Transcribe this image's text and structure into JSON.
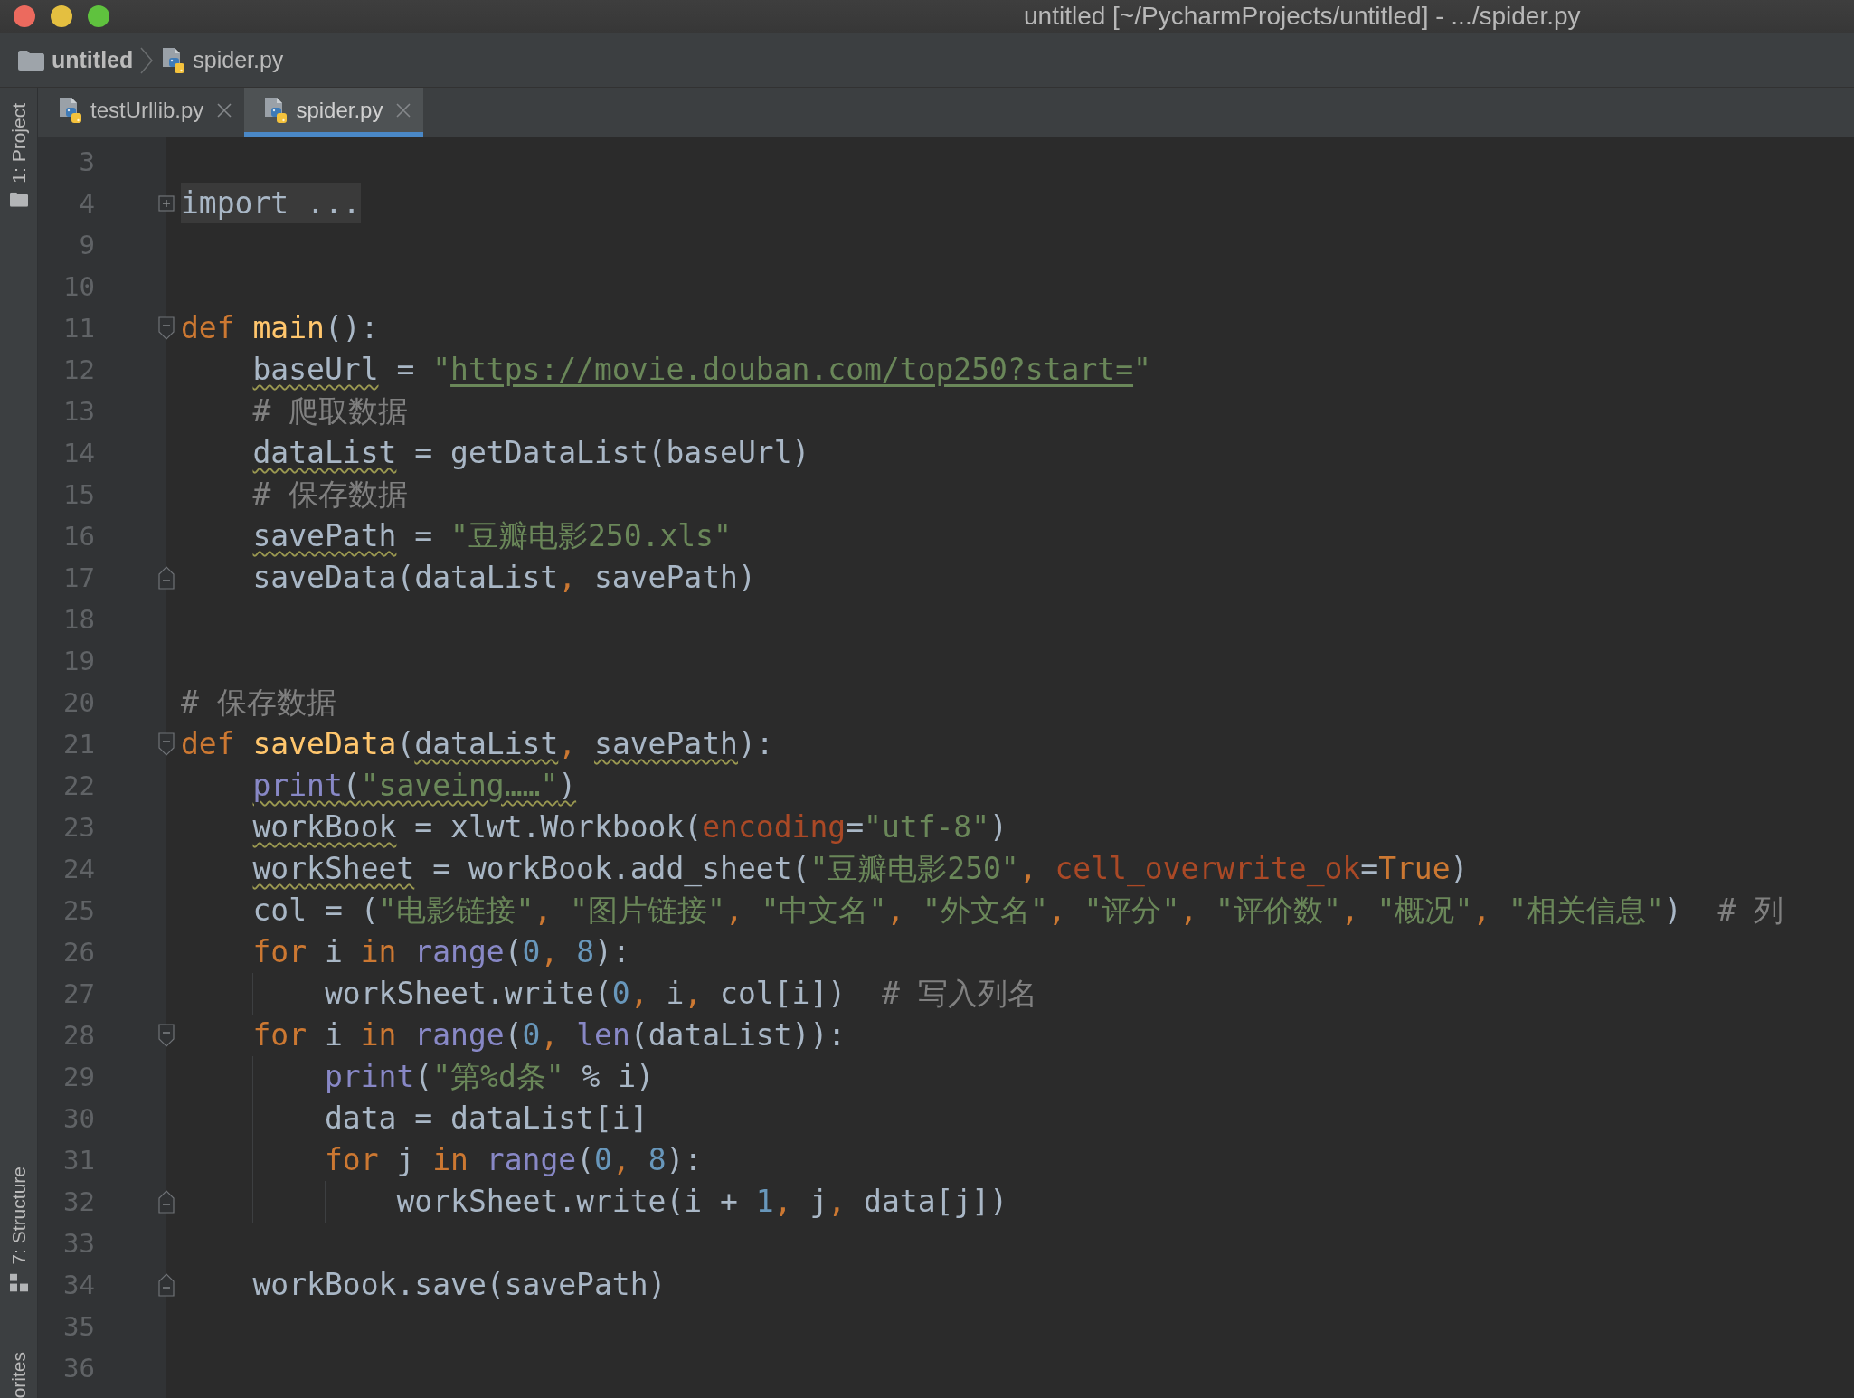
{
  "window": {
    "title": "untitled [~/PycharmProjects/untitled] - .../spider.py"
  },
  "breadcrumbs": [
    {
      "kind": "folder",
      "label": "untitled"
    },
    {
      "kind": "python_file",
      "label": "spider.py"
    }
  ],
  "tool_windows": {
    "top": [
      {
        "kind": "project",
        "label": "1: Project"
      }
    ],
    "bottom": [
      {
        "kind": "structure",
        "label": "7: Structure"
      },
      {
        "kind": "favorites",
        "label": "orites"
      }
    ]
  },
  "tabs": [
    {
      "label": "testUrllib.py",
      "selected": false
    },
    {
      "label": "spider.py",
      "selected": true
    }
  ],
  "editor": {
    "lines": [
      {
        "number": "3"
      },
      {
        "number": "4",
        "fold": {
          "kind": "start",
          "collapsed": true
        },
        "tokens": [
          {
            "kind": "folded",
            "text": "import ...",
            "warning": false
          }
        ]
      },
      {
        "number": "9"
      },
      {
        "number": "10"
      },
      {
        "number": "11",
        "fold": {
          "kind": "start",
          "collapsed": false
        },
        "tokens": [
          {
            "kind": "keyword",
            "text": "def ",
            "warning": false
          },
          {
            "kind": "function",
            "text": "main",
            "warning": false
          },
          {
            "kind": "plain",
            "text": "():",
            "warning": false
          }
        ]
      },
      {
        "number": "12",
        "tokens": [
          {
            "kind": "plain",
            "text": "    baseUrl",
            "warning": true
          },
          {
            "kind": "plain",
            "text": " = ",
            "warning": false
          },
          {
            "kind": "string",
            "text": "\"",
            "warning": false
          },
          {
            "kind": "url",
            "text": "https://movie.douban.com/top250?start=",
            "warning": false
          },
          {
            "kind": "string",
            "text": "\"",
            "warning": false
          }
        ]
      },
      {
        "number": "13",
        "tokens": [
          {
            "kind": "comment",
            "text": "    # 爬取数据",
            "warning": false
          }
        ]
      },
      {
        "number": "14",
        "tokens": [
          {
            "kind": "plain",
            "text": "    dataList",
            "warning": true
          },
          {
            "kind": "plain",
            "text": " = getDataList(baseUrl)",
            "warning": false
          }
        ]
      },
      {
        "number": "15",
        "tokens": [
          {
            "kind": "comment",
            "text": "    # 保存数据",
            "warning": false
          }
        ]
      },
      {
        "number": "16",
        "tokens": [
          {
            "kind": "plain",
            "text": "    savePath",
            "warning": true
          },
          {
            "kind": "plain",
            "text": " = ",
            "warning": false
          },
          {
            "kind": "string",
            "text": "\"豆瓣电影250.xls\"",
            "warning": false
          }
        ]
      },
      {
        "number": "17",
        "fold": {
          "kind": "end",
          "collapsed": false
        },
        "tokens": [
          {
            "kind": "plain",
            "text": "    saveData(dataList",
            "warning": false
          },
          {
            "kind": "comma",
            "text": ", ",
            "warning": false
          },
          {
            "kind": "plain",
            "text": "savePath)",
            "warning": false
          }
        ]
      },
      {
        "number": "18"
      },
      {
        "number": "19"
      },
      {
        "number": "20",
        "tokens": [
          {
            "kind": "comment",
            "text": "# 保存数据",
            "warning": false
          }
        ]
      },
      {
        "number": "21",
        "fold": {
          "kind": "start",
          "collapsed": false
        },
        "tokens": [
          {
            "kind": "keyword",
            "text": "def ",
            "warning": false
          },
          {
            "kind": "function",
            "text": "saveData",
            "warning": false
          },
          {
            "kind": "plain",
            "text": "(",
            "warning": false
          },
          {
            "kind": "plain",
            "text": "dataList",
            "warning": true
          },
          {
            "kind": "comma",
            "text": ", ",
            "warning": false
          },
          {
            "kind": "plain",
            "text": "savePath",
            "warning": true
          },
          {
            "kind": "plain",
            "text": "):",
            "warning": false
          }
        ]
      },
      {
        "number": "22",
        "tokens": [
          {
            "kind": "builtin",
            "text": "    print",
            "warning": true
          },
          {
            "kind": "plain",
            "text": "(",
            "warning": true
          },
          {
            "kind": "string",
            "text": "\"saveing……\"",
            "warning": true
          },
          {
            "kind": "plain",
            "text": ")",
            "warning": true
          }
        ]
      },
      {
        "number": "23",
        "tokens": [
          {
            "kind": "plain",
            "text": "    workBook",
            "warning": true
          },
          {
            "kind": "plain",
            "text": " = xlwt.Workbook(",
            "warning": false
          },
          {
            "kind": "kwarg",
            "text": "encoding",
            "warning": false
          },
          {
            "kind": "plain",
            "text": "=",
            "warning": false
          },
          {
            "kind": "string",
            "text": "\"utf-8\"",
            "warning": false
          },
          {
            "kind": "plain",
            "text": ")",
            "warning": false
          }
        ]
      },
      {
        "number": "24",
        "tokens": [
          {
            "kind": "plain",
            "text": "    workSheet",
            "warning": true
          },
          {
            "kind": "plain",
            "text": " = workBook.add_sheet(",
            "warning": false
          },
          {
            "kind": "string",
            "text": "\"豆瓣电影250\"",
            "warning": false
          },
          {
            "kind": "comma",
            "text": ", ",
            "warning": false
          },
          {
            "kind": "kwarg",
            "text": "cell_overwrite_ok",
            "warning": false
          },
          {
            "kind": "plain",
            "text": "=",
            "warning": false
          },
          {
            "kind": "keyword",
            "text": "True",
            "warning": false
          },
          {
            "kind": "plain",
            "text": ")",
            "warning": false
          }
        ]
      },
      {
        "number": "25",
        "tokens": [
          {
            "kind": "plain",
            "text": "    col = (",
            "warning": false
          },
          {
            "kind": "string",
            "text": "\"电影链接\"",
            "warning": false
          },
          {
            "kind": "comma",
            "text": ", ",
            "warning": false
          },
          {
            "kind": "string",
            "text": "\"图片链接\"",
            "warning": false
          },
          {
            "kind": "comma",
            "text": ", ",
            "warning": false
          },
          {
            "kind": "string",
            "text": "\"中文名\"",
            "warning": false
          },
          {
            "kind": "comma",
            "text": ", ",
            "warning": false
          },
          {
            "kind": "string",
            "text": "\"外文名\"",
            "warning": false
          },
          {
            "kind": "comma",
            "text": ", ",
            "warning": false
          },
          {
            "kind": "string",
            "text": "\"评分\"",
            "warning": false
          },
          {
            "kind": "comma",
            "text": ", ",
            "warning": false
          },
          {
            "kind": "string",
            "text": "\"评价数\"",
            "warning": false
          },
          {
            "kind": "comma",
            "text": ", ",
            "warning": false
          },
          {
            "kind": "string",
            "text": "\"概况\"",
            "warning": false
          },
          {
            "kind": "comma",
            "text": ", ",
            "warning": false
          },
          {
            "kind": "string",
            "text": "\"相关信息\"",
            "warning": false
          },
          {
            "kind": "plain",
            "text": ")  ",
            "warning": false
          },
          {
            "kind": "comment",
            "text": "# 列",
            "warning": false
          }
        ]
      },
      {
        "number": "26",
        "tokens": [
          {
            "kind": "keyword",
            "text": "    for ",
            "warning": false
          },
          {
            "kind": "plain",
            "text": "i ",
            "warning": false
          },
          {
            "kind": "keyword",
            "text": "in ",
            "warning": false
          },
          {
            "kind": "builtin",
            "text": "range",
            "warning": false
          },
          {
            "kind": "plain",
            "text": "(",
            "warning": false
          },
          {
            "kind": "number",
            "text": "0",
            "warning": false
          },
          {
            "kind": "comma",
            "text": ", ",
            "warning": false
          },
          {
            "kind": "number",
            "text": "8",
            "warning": false
          },
          {
            "kind": "plain",
            "text": "):",
            "warning": false
          }
        ]
      },
      {
        "number": "27",
        "tokens": [
          {
            "kind": "plain",
            "text": "        workSheet.write(",
            "warning": false
          },
          {
            "kind": "number",
            "text": "0",
            "warning": false
          },
          {
            "kind": "comma",
            "text": ", ",
            "warning": false
          },
          {
            "kind": "plain",
            "text": "i",
            "warning": false
          },
          {
            "kind": "comma",
            "text": ", ",
            "warning": false
          },
          {
            "kind": "plain",
            "text": "col[i])  ",
            "warning": false
          },
          {
            "kind": "comment",
            "text": "# 写入列名",
            "warning": false
          }
        ]
      },
      {
        "number": "28",
        "fold": {
          "kind": "start",
          "collapsed": false
        },
        "tokens": [
          {
            "kind": "keyword",
            "text": "    for ",
            "warning": false
          },
          {
            "kind": "plain",
            "text": "i ",
            "warning": false
          },
          {
            "kind": "keyword",
            "text": "in ",
            "warning": false
          },
          {
            "kind": "builtin",
            "text": "range",
            "warning": false
          },
          {
            "kind": "plain",
            "text": "(",
            "warning": false
          },
          {
            "kind": "number",
            "text": "0",
            "warning": false
          },
          {
            "kind": "comma",
            "text": ", ",
            "warning": false
          },
          {
            "kind": "builtin",
            "text": "len",
            "warning": false
          },
          {
            "kind": "plain",
            "text": "(dataList)):",
            "warning": false
          }
        ]
      },
      {
        "number": "29",
        "tokens": [
          {
            "kind": "builtin",
            "text": "        print",
            "warning": false
          },
          {
            "kind": "plain",
            "text": "(",
            "warning": false
          },
          {
            "kind": "string",
            "text": "\"第%d条\"",
            "warning": false
          },
          {
            "kind": "plain",
            "text": " % i)",
            "warning": false
          }
        ]
      },
      {
        "number": "30",
        "tokens": [
          {
            "kind": "plain",
            "text": "        data = dataList[i]",
            "warning": false
          }
        ]
      },
      {
        "number": "31",
        "tokens": [
          {
            "kind": "keyword",
            "text": "        for ",
            "warning": false
          },
          {
            "kind": "plain",
            "text": "j ",
            "warning": false
          },
          {
            "kind": "keyword",
            "text": "in ",
            "warning": false
          },
          {
            "kind": "builtin",
            "text": "range",
            "warning": false
          },
          {
            "kind": "plain",
            "text": "(",
            "warning": false
          },
          {
            "kind": "number",
            "text": "0",
            "warning": false
          },
          {
            "kind": "comma",
            "text": ", ",
            "warning": false
          },
          {
            "kind": "number",
            "text": "8",
            "warning": false
          },
          {
            "kind": "plain",
            "text": "):",
            "warning": false
          }
        ]
      },
      {
        "number": "32",
        "fold": {
          "kind": "end",
          "collapsed": false
        },
        "tokens": [
          {
            "kind": "plain",
            "text": "            workSheet.write(i + ",
            "warning": false
          },
          {
            "kind": "number",
            "text": "1",
            "warning": false
          },
          {
            "kind": "comma",
            "text": ", ",
            "warning": false
          },
          {
            "kind": "plain",
            "text": "j",
            "warning": false
          },
          {
            "kind": "comma",
            "text": ", ",
            "warning": false
          },
          {
            "kind": "plain",
            "text": "data[j])",
            "warning": false
          }
        ]
      },
      {
        "number": "33"
      },
      {
        "number": "34",
        "fold": {
          "kind": "end",
          "collapsed": false
        },
        "tokens": [
          {
            "kind": "plain",
            "text": "    workBook.save(savePath)",
            "warning": false
          }
        ]
      },
      {
        "number": "35"
      },
      {
        "number": "36"
      }
    ]
  }
}
